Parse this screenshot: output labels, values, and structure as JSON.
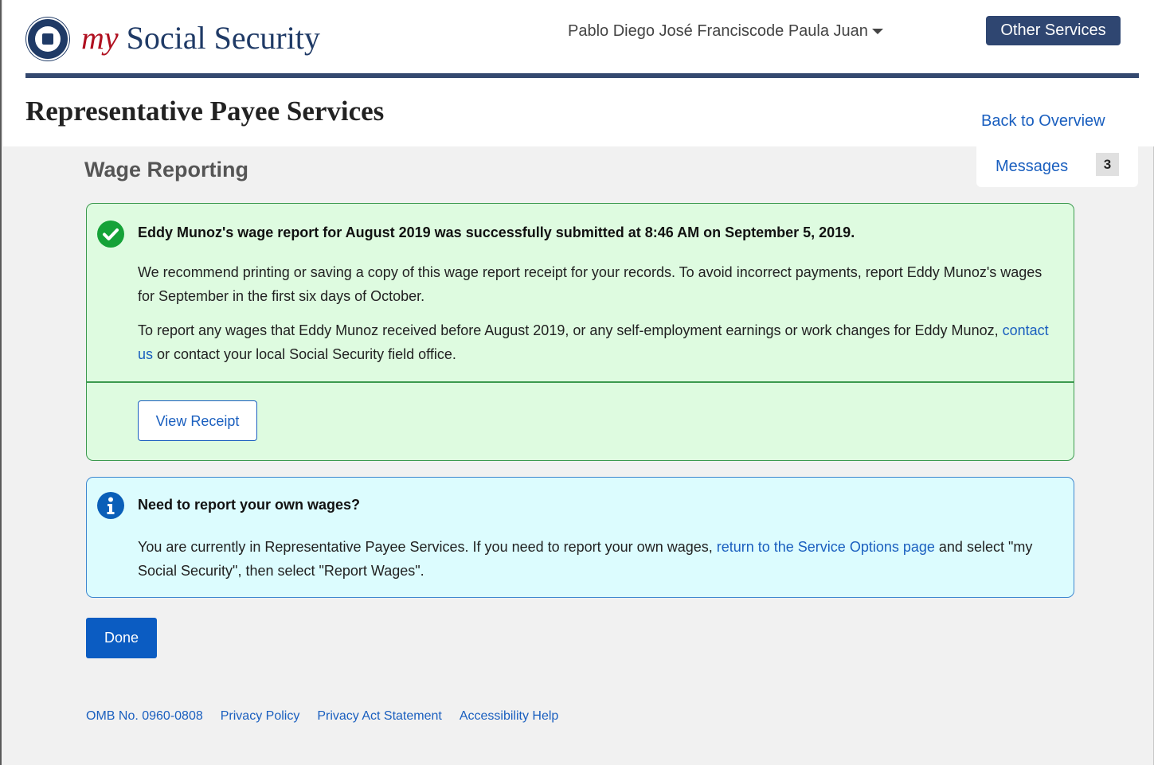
{
  "header": {
    "brand_my": "my",
    "brand_rest": "Social Security",
    "user_name": "Pablo Diego José Franciscode Paula Juan",
    "other_services_label": "Other Services"
  },
  "page": {
    "title": "Representative Payee Services",
    "back_link": "Back to Overview",
    "messages_label": "Messages",
    "messages_count": "3",
    "section_title": "Wage Reporting"
  },
  "success_alert": {
    "heading": "Eddy Munoz's wage report for August 2019 was successfully submitted at 8:46 AM on September 5, 2019.",
    "paragraph1": "We recommend printing or saving a copy of this wage report receipt for your records. To avoid incorrect payments, report Eddy Munoz's wages for September in the first six days of October.",
    "paragraph2_before": "To report any wages that Eddy Munoz received before August 2019, or any self-employment earnings or work changes for Eddy Munoz, ",
    "paragraph2_link": "contact us",
    "paragraph2_after": " or contact your local Social Security field office.",
    "view_receipt_label": "View Receipt"
  },
  "info_alert": {
    "heading": "Need to report your own wages?",
    "body_before": "You are currently in Representative Payee Services. If you need to report your own wages, ",
    "body_link": "return to the Service Options page",
    "body_after": " and select \"my Social Security\", then select \"Report Wages\"."
  },
  "done_label": "Done",
  "footer": {
    "omb": "OMB No. 0960-0808",
    "privacy_policy": "Privacy Policy",
    "privacy_act": "Privacy Act Statement",
    "accessibility": "Accessibility Help"
  },
  "colors": {
    "brand_navy": "#1f3a66",
    "brand_red": "#b01020",
    "link_blue": "#1a5fbf",
    "success_bg": "#defbe0",
    "success_border": "#3c9a4f",
    "info_bg": "#dcfcfe",
    "info_border": "#3d87cf",
    "primary_button": "#0b5cc2"
  },
  "icons": {
    "logo": "ssa-seal-icon",
    "success": "check-circle-icon",
    "info": "info-circle-icon",
    "dropdown": "caret-down-icon"
  }
}
